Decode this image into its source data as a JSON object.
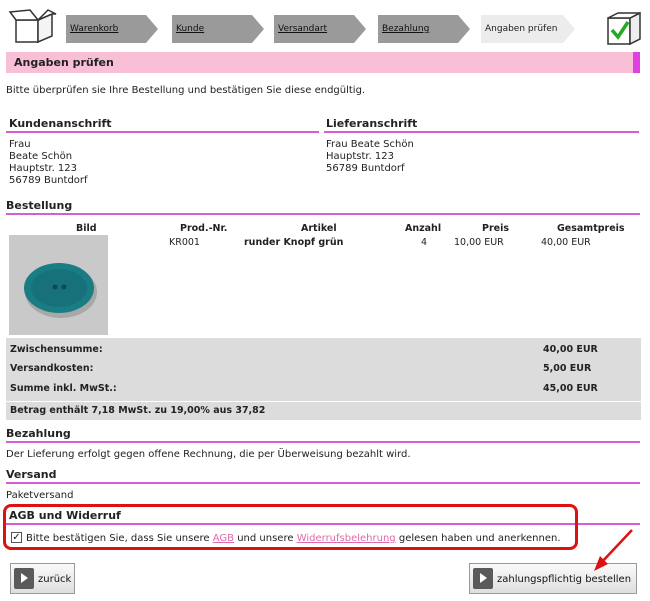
{
  "steps": [
    {
      "label": "Warenkorb",
      "active": false
    },
    {
      "label": "Kunde",
      "active": false
    },
    {
      "label": "Versandart",
      "active": false
    },
    {
      "label": "Bezahlung",
      "active": false
    },
    {
      "label": "Angaben prüfen",
      "active": true
    }
  ],
  "page_title": "Angaben prüfen",
  "intro": "Bitte überprüfen sie Ihre Bestellung und bestätigen Sie diese endgültig.",
  "billing": {
    "heading": "Kundenanschrift",
    "lines": [
      "Frau",
      "Beate Schön",
      "Hauptstr. 123",
      "56789 Buntdorf"
    ]
  },
  "shipping_addr": {
    "heading": "Lieferanschrift",
    "lines": [
      "Frau Beate Schön",
      "Hauptstr. 123",
      "56789 Buntdorf"
    ]
  },
  "order": {
    "heading": "Bestellung",
    "columns": [
      "Bild",
      "Prod.-Nr.",
      "Artikel",
      "Anzahl",
      "Preis",
      "Gesamtpreis"
    ],
    "row": {
      "prodnr": "KR001",
      "article": "runder Knopf grün",
      "qty": "4",
      "price": "10,00 EUR",
      "total": "40,00 EUR"
    },
    "subtotal_label": "Zwischensumme:",
    "subtotal": "40,00 EUR",
    "shipping_label": "Versandkosten:",
    "shipping_cost": "5,00 EUR",
    "sum_label": "Summe inkl. MwSt.:",
    "sum": "45,00 EUR",
    "tax_note": "Betrag enthält 7,18 MwSt. zu 19,00% aus 37,82"
  },
  "payment": {
    "heading": "Bezahlung",
    "text": "Der Lieferung erfolgt gegen offene Rechnung, die per Überweisung bezahlt wird."
  },
  "delivery": {
    "heading": "Versand",
    "text": "Paketversand"
  },
  "agb": {
    "heading": "AGB und Widerruf",
    "checked": "✓",
    "text_before": "Bitte bestätigen Sie, dass Sie unsere",
    "link1": "AGB",
    "text_mid": "und unsere",
    "link2": "Widerrufsbelehrung",
    "text_after": "gelesen haben und anerkennen."
  },
  "buttons": {
    "back": "zurück",
    "order": "zahlungspflichtig bestellen"
  },
  "colors": {
    "accent": "#d45fd4",
    "title_bg": "#f8bfd6",
    "highlight": "#dd1111"
  }
}
